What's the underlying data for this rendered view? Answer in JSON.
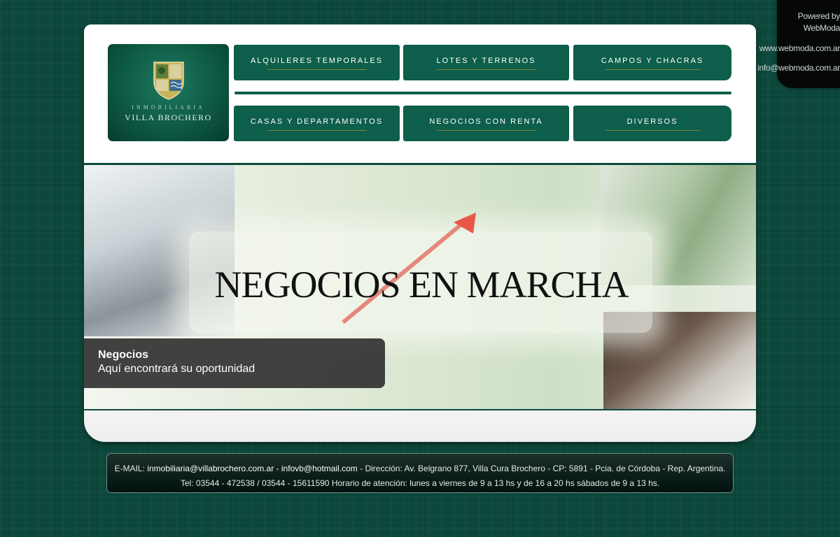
{
  "powered": {
    "line1": "Powered by",
    "line2": "WebModa",
    "website": "www.webmoda.com.ar",
    "email": "info@webmoda.com.ar"
  },
  "logo": {
    "line1": "INMOBILIARIA",
    "line2": "VILLA BROCHERO"
  },
  "nav": {
    "row1": [
      "ALQUILERES TEMPORALES",
      "LOTES Y TERRENOS",
      "CAMPOS Y CHACRAS"
    ],
    "row2": [
      "CASAS Y DEPARTAMENTOS",
      "NEGOCIOS CON RENTA",
      "DIVERSOS"
    ]
  },
  "banner": {
    "title": "NEGOCIOS EN MARCHA",
    "caption_title": "Negocios",
    "caption_text": "Aquí encontrará su oportunidad"
  },
  "footer": {
    "email_label": "E-MAIL:",
    "email1": "inmobiliaria@villabrochero.com.ar",
    "sep": "-",
    "email2": "infovb@hotmail.com",
    "address": "- Dirección: Av. Belgrano 877, Villa Cura Brochero - CP: 5891 - Pcia. de Córdoba - Rep. Argentina.",
    "phones": "Tel: 03544 - 472538 / 03544 - 15611590 Horario de atención: lunes a viernes de 9 a 13 hs y de 16 a 20 hs sábados de 9 a 13 hs."
  },
  "colors": {
    "background": "#0d4a3d",
    "nav_button": "#0d5e4a",
    "caption_bg": "#2d2d2d"
  }
}
